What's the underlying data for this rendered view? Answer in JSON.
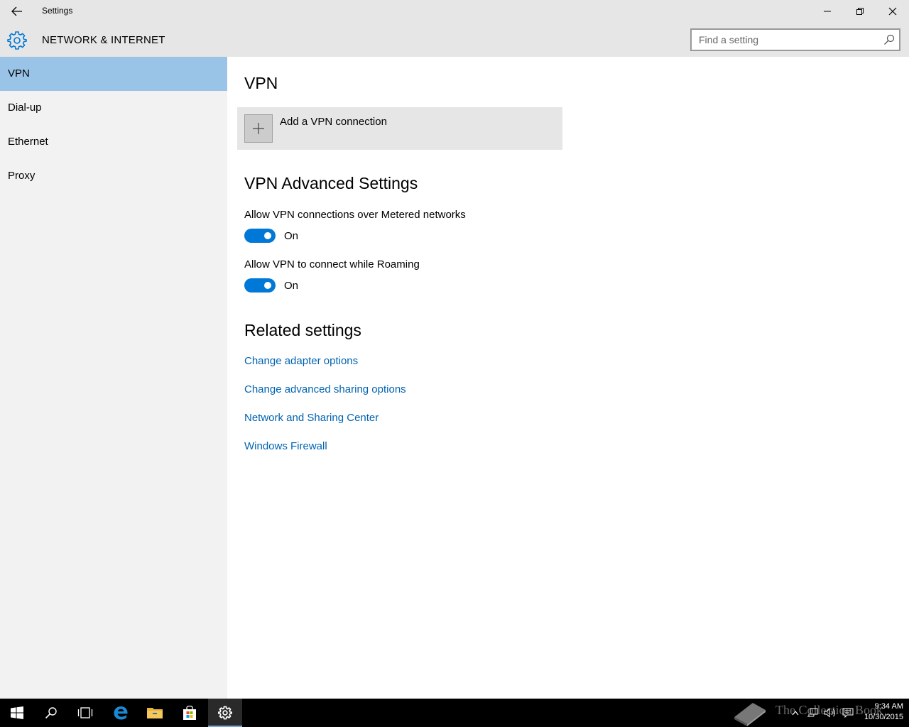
{
  "window": {
    "title": "Settings",
    "minimize_icon": "minimize-icon",
    "maximize_icon": "restore-icon",
    "close_icon": "close-icon"
  },
  "header": {
    "section_title": "NETWORK & INTERNET",
    "search_placeholder": "Find a setting"
  },
  "sidebar": {
    "items": [
      {
        "label": "VPN",
        "active": true
      },
      {
        "label": "Dial-up",
        "active": false
      },
      {
        "label": "Ethernet",
        "active": false
      },
      {
        "label": "Proxy",
        "active": false
      }
    ]
  },
  "main": {
    "vpn_heading": "VPN",
    "add_vpn_label": "Add a VPN connection",
    "advanced_heading": "VPN Advanced Settings",
    "options": [
      {
        "label": "Allow VPN connections over Metered networks",
        "state": "On",
        "enabled": true
      },
      {
        "label": "Allow VPN to connect while Roaming",
        "state": "On",
        "enabled": true
      }
    ],
    "related_heading": "Related settings",
    "links": [
      "Change adapter options",
      "Change advanced sharing options",
      "Network and Sharing Center",
      "Windows Firewall"
    ]
  },
  "taskbar": {
    "time": "9:34 AM",
    "date": "10/30/2015",
    "watermark": "The Collection Book",
    "icons": [
      "start-icon",
      "search-icon",
      "task-view-icon",
      "edge-icon",
      "file-explorer-icon",
      "store-icon",
      "settings-icon"
    ]
  },
  "colors": {
    "accent": "#0078d7",
    "nav_active": "#99c4e8",
    "link": "#0063b1"
  }
}
